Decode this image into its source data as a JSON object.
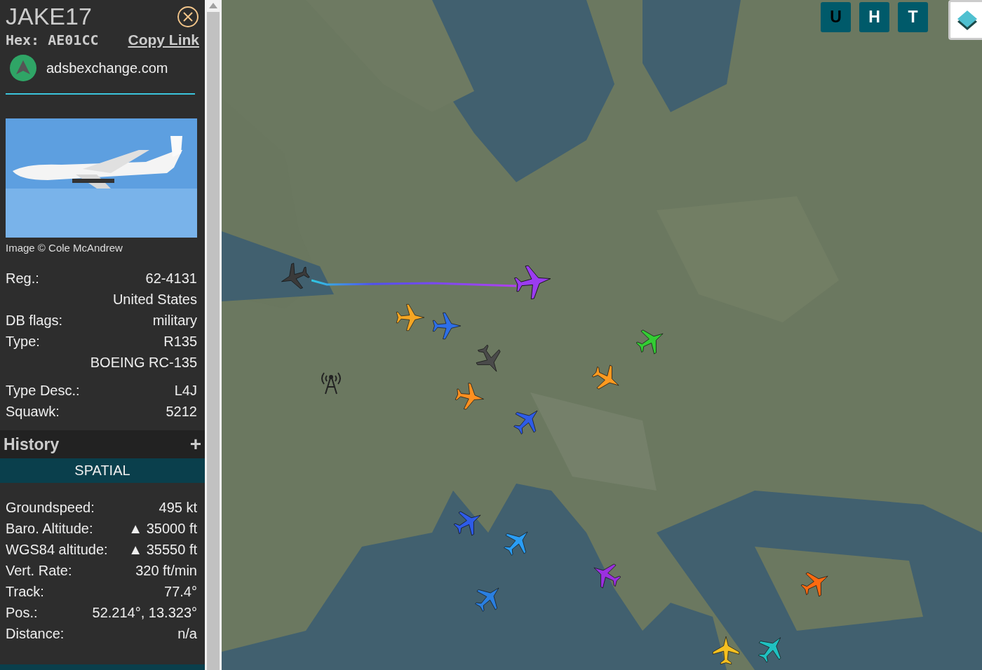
{
  "sidebar": {
    "callsign": "JAKE17",
    "hex_label": "Hex:",
    "hex": "AE01CC",
    "copy_link": "Copy Link",
    "source": "adsbexchange.com",
    "photo": {
      "kind": "picture",
      "caption": "Image © Cole McAndrew"
    },
    "details": [
      {
        "label": "Reg.:",
        "value": "62-4131"
      },
      {
        "value": "United States"
      },
      {
        "label": "DB flags:",
        "value": "military"
      },
      {
        "label": "Type:",
        "value": "R135"
      },
      {
        "value": "BOEING RC-135"
      },
      {
        "label": "Type Desc.:",
        "value": "L4J"
      },
      {
        "label": "Squawk:",
        "value": "5212"
      }
    ],
    "history": {
      "title": "History",
      "expand": "+"
    },
    "section": "SPATIAL",
    "spatial": [
      {
        "label": "Groundspeed:",
        "value": "495 kt"
      },
      {
        "label": "Baro. Altitude:",
        "value": "▲ 35000 ft"
      },
      {
        "label": "WGS84 altitude:",
        "value": "▲ 35550 ft"
      },
      {
        "label": "Vert. Rate:",
        "value": "320 ft/min"
      },
      {
        "label": "Track:",
        "value": "77.4°"
      },
      {
        "label": "Pos.:",
        "value": "52.214°, 13.323°"
      },
      {
        "label": "Distance:",
        "value": "n/a"
      }
    ]
  },
  "map_buttons": [
    {
      "label": "U",
      "on": true
    },
    {
      "label": "H",
      "on": false
    },
    {
      "label": "T",
      "on": false
    }
  ],
  "aircraft": [
    {
      "color": "#3a3a3a",
      "selected": false
    },
    {
      "color": "#9b3cf0",
      "selected": true
    },
    {
      "color": "#f5a623",
      "selected": false
    },
    {
      "color": "#2e6fe8",
      "selected": false
    },
    {
      "color": "#4a4a4a",
      "selected": false
    },
    {
      "color": "#ff9020",
      "selected": false
    },
    {
      "color": "#2e5ce8",
      "selected": false
    },
    {
      "color": "#ff9a20",
      "selected": false
    },
    {
      "color": "#33cc33",
      "selected": false
    },
    {
      "color": "#2e5ce8",
      "selected": false
    },
    {
      "color": "#2a9df4",
      "selected": false
    },
    {
      "color": "#2a7fe0",
      "selected": false
    },
    {
      "color": "#9b30e0",
      "selected": false
    },
    {
      "color": "#ff6a10",
      "selected": false
    },
    {
      "color": "#f5c020",
      "selected": false
    },
    {
      "color": "#20c0c0",
      "selected": false
    }
  ]
}
